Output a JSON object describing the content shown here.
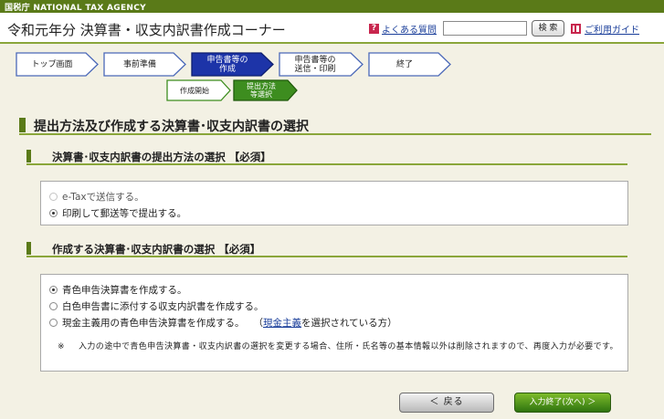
{
  "topbar": {
    "agency": "国税庁 NATIONAL TAX AGENCY"
  },
  "header": {
    "title": "令和元年分 決算書・収支内訳書作成コーナー",
    "faq_label": "よくある質問",
    "faq_icon": "question-icon",
    "search_placeholder": "",
    "search_button": "検 索",
    "guide_label": "ご利用ガイド",
    "guide_icon": "book-icon"
  },
  "steps": {
    "main": [
      {
        "label": "トップ画面",
        "state": "done"
      },
      {
        "label": "事前準備",
        "state": "done"
      },
      {
        "label": "申告書等の\n作成",
        "state": "active"
      },
      {
        "label": "申告書等の\n送信・印刷",
        "state": "todo"
      },
      {
        "label": "終了",
        "state": "todo"
      }
    ],
    "sub": [
      {
        "label": "作成開始",
        "state": "done"
      },
      {
        "label": "提出方法\n等選択",
        "state": "active"
      }
    ]
  },
  "page": {
    "heading": "提出方法及び作成する決算書･収支内訳書の選択"
  },
  "section1": {
    "heading": "決算書･収支内訳書の提出方法の選択 【必須】",
    "options": [
      {
        "label": "e-Taxで送信する。",
        "checked": false,
        "disabled": true
      },
      {
        "label": "印刷して郵送等で提出する。",
        "checked": true,
        "disabled": false
      }
    ]
  },
  "section2": {
    "heading": "作成する決算書･収支内訳書の選択 【必須】",
    "options": [
      {
        "label": "青色申告決算書を作成する。",
        "checked": true
      },
      {
        "label": "白色申告書に添付する収支内訳書を作成する。",
        "checked": false
      },
      {
        "label": "現金主義用の青色申告決算書を作成する。",
        "checked": false
      }
    ],
    "option3_note_prefix": "（",
    "option3_note_link": "現金主義",
    "option3_note_suffix": "を選択されている方）",
    "note_mark": "※",
    "note_text": "入力の途中で青色申告決算書・収支内訳書の選択を変更する場合、住所・氏名等の基本情報以外は削除されますので、再度入力が必要です。"
  },
  "footer": {
    "back_label": "＜ 戻る",
    "next_label": "入力終了(次へ) ＞"
  },
  "colors": {
    "accent_green": "#5a7a18",
    "active_step": "#1d34a8",
    "substep_active": "#3d8d1f"
  }
}
